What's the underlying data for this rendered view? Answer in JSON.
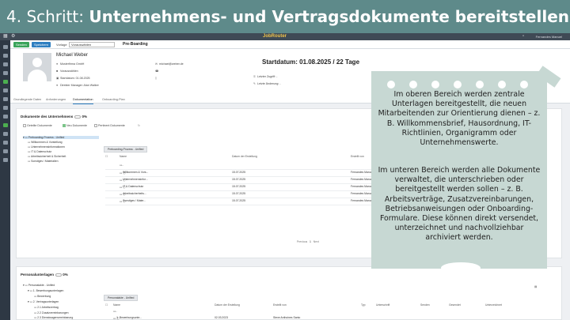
{
  "banner": {
    "step": "4. Schritt: ",
    "title": "Unternehmens- und Vertragsdokumente bereitstellen"
  },
  "app": {
    "logo": "JobRouter",
    "user": "Fernandes Manuel"
  },
  "toolbar": {
    "save": "Senden",
    "save2": "Speichern",
    "template_label": "Vorlage",
    "template_value": "Vorauswählen",
    "process": "Pre-Boarding"
  },
  "profile": {
    "name": "Michael Weber",
    "company": "Musterfirma GmbH",
    "status": "Vorauswählen",
    "start_date": "Startdatum: 01.08.2025",
    "manager": "Direkter Manager: Alan Walker",
    "email": "michael@weber.de",
    "headline": "Startdatum: 01.08.2025 / 22 Tage",
    "last_access": "Letzter Zugriff: -",
    "last_change": "Letzte Änderung: -"
  },
  "tabs": [
    "Grundlegende Daten",
    "Anforderungen",
    "Dokumentation",
    "Onboarding-Plan"
  ],
  "company_docs": {
    "title": "Dokumente des Unternehmens",
    "count": "0%",
    "filters": [
      "Geteilte Dokumente",
      "Neu Dokumente",
      "Pertinent Dokumente"
    ],
    "tree": [
      "Preboarding-Prozess - Unified",
      "Willkommen & Vorstellung",
      "Unternehmensinformationen",
      "IT & Datenschutz",
      "Arbeitssicherheit & Sicherheit",
      "Sonstiges / Materialien"
    ],
    "folder_tab": "Preboarding-Prozess - Unified",
    "columns": [
      "Name",
      "Datum der Erstellung",
      "Erstellt von"
    ],
    "rows": [
      {
        "name": "..",
        "date": "",
        "by": ""
      },
      {
        "name": "Willkommen & Vors...",
        "date": "15.07.2025",
        "by": "Fernandes Manuel"
      },
      {
        "name": "Unternehmensinfor...",
        "date": "15.07.2025",
        "by": "Fernandes Manuel"
      },
      {
        "name": "IT & Datenschutz",
        "date": "15.07.2025",
        "by": "Fernandes Manuel"
      },
      {
        "name": "Arbeitssicherheits...",
        "date": "15.07.2025",
        "by": "Fernandes Manuel"
      },
      {
        "name": "Sonstiges / Mater...",
        "date": "15.07.2025",
        "by": "Fernandes Manuel"
      }
    ],
    "pager": {
      "prev": "Previous",
      "page": "1",
      "next": "Next"
    }
  },
  "personal_docs": {
    "title": "Personalunterlagen",
    "count": "0%",
    "tree": [
      "Personalakte - Unified",
      "1. Bewerbungsunterlagen",
      "Bewerbung",
      "2. Vertragsunterlagen",
      "2.1 Arbeitsvertrag",
      "2.2 Zusatzvereinbarungen",
      "2.3 Dienstwagenvereinbarung"
    ],
    "folder_tab": "Personalakte - Unified",
    "columns": [
      "Name",
      "Datum der Erstellung",
      "Erstellt von",
      "Typ",
      "Unterschrift",
      "Senden",
      "Gesendet",
      "Unterzeichnet"
    ],
    "rows": [
      {
        "name": "..",
        "date": "",
        "by": ""
      },
      {
        "name": "1. Bewerbungsunte...",
        "date": "02.03.2023",
        "by": "Steve Anthoines Santo"
      }
    ]
  },
  "note": {
    "para1": "Im oberen Bereich werden zentrale Unterlagen bereitgestellt, die neuen Mitarbeitenden zur Orientierung dienen – z. B. Willkommensbrief, Hausordnung, IT-Richtlinien, Organigramm oder Unternehmenswerte.",
    "para2": "Im unteren Bereich werden alle Dokumente verwaltet, die unterschrieben oder bereitgestellt werden sollen – z. B. Arbeitsverträge, Zusatzvereinbarungen, Betriebsanweisungen oder Onboarding-Formulare. Diese können direkt versendet, unterzeichnet und nachvollziehbar archiviert werden."
  }
}
